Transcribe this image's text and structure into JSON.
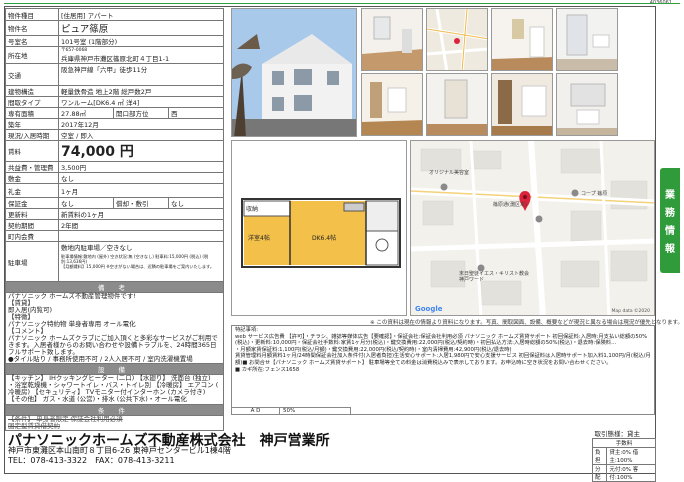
{
  "doc_id": "4036061",
  "rows": [
    {
      "label": "物件種目",
      "value": "[住居用] アパート"
    },
    {
      "label": "物件名",
      "value": "ピュア篠原"
    },
    {
      "label": "号室名",
      "value": "101号室 (1階部分)"
    },
    {
      "label": "所在地",
      "small": "〒657-0068",
      "value": "兵庫県神戸市灘区篠原北町４丁目1-1"
    },
    {
      "label": "交通",
      "value": "阪急神戸線「六甲」徒歩11分"
    },
    {
      "label": "建物構造",
      "value": "軽量鉄骨造 地上2階 総戸数2戸"
    },
    {
      "label": "間取タイプ",
      "value": "ワンルーム[DK6.4 ㎡ 洋4]"
    },
    {
      "label": "専有面積",
      "value": "27.88㎡",
      "label2": "開口部方位",
      "value2": "西"
    },
    {
      "label": "築年",
      "value": "2017年12月"
    },
    {
      "label": "現況/入居時期",
      "value": "空室 / 即入"
    },
    {
      "label": "賃料",
      "value": "74,000 円"
    },
    {
      "label": "共益費・管理費",
      "value": "3,500円"
    },
    {
      "label": "敷金",
      "value": "なし"
    },
    {
      "label": "礼金",
      "value": "1ヶ月"
    },
    {
      "label": "保証金",
      "value": "なし",
      "label2": "償却・敷引",
      "value2": "なし"
    },
    {
      "label": "更新料",
      "value": "新賃料の1ヶ月"
    },
    {
      "label": "契約期間",
      "value": "2年間"
    },
    {
      "label": "町内会費",
      "value": ""
    },
    {
      "label": "駐車場",
      "value": "敷地内駐車場／空きなし",
      "small": "駐車場情報:敷地内 (屋外) 空き状況:無 (空きなし) 駐車料:15,000円 (税込) (税別:13,636円)\n【月額賃料】15,000円 ※空きがない場合は、近隣の駐車場をご案内いたします。"
    }
  ],
  "section_biko": "備 考",
  "biko_text": "パナソニック ホームズ不動産管理物件です!\n【賃貸】\n即入居(内覧可)\n【特徴】\nパナソニック特約物 単身者専用 オール電化\n【コメント】\nパナソニック ホームズクラブにご加入頂くと多彩なサービスがご利用できます。入居者様からのお問い合わせや設備トラブルを、24時間365日フルサポート致します。\n●タイル貼り / 事務所使用不可 / 2人入居不可 / 室内洗濯機置場",
  "section_setsubi": "設 備",
  "setsubi_text": "【キッチン】 IHクッキングヒーター (二口) 【水廻り】 洗面台 (独立)\n・浴室乾燥機・シャワートイレ・バス・トイレ別 【冷暖房】 エアコン (\n冷暖房) 【セキュリティ】 TVモニター付インターホン (カメラ付き)\n【その他】 ガス・水道 (公営)・排水 (公共下水)・オール電化",
  "section_joken": "条 件",
  "joken_text": "【条件】 単身者限定 保証会社利用必須\n固定型賃貸借契約",
  "floor_plan": {
    "closet": "収納",
    "room": "洋室4帖",
    "dk": "DK6.4帖"
  },
  "map": {
    "labels": [
      "オリジナル美容室",
      "篠原通(灘区本)",
      "コープ 篠原",
      "末日聖徒イエス・キリスト教会 神戸ワード",
      "Google",
      "Map data ©2020"
    ]
  },
  "caption": "※ この資料は現在の情報より資料になります。写真、間取図面、設備、概要などが現況と異なる場合は現況が優先となります。",
  "remarks": "特記事項:\nweb サービス広告費 【許可】・チラシ、雑誌等媒体広告【要確認】・保証会社:保証会社利用必須 パナソニック ホームズ賃貸サポート 初回保証料:入居時:月支払い総額の50%(税込)・更新料:10,000円・保証会社手数料:家賃1ヶ月分(税込)・鍵交換費用:22,000円(税込/契約時)・初回払込方法:入居時総額の50%(税込)・退去時:保険料…\n・月額家賃保証料:1,100円(税込/月額)・鍵交換費用:22,000円(税込/契約時)・室内清掃費用:42,900円(税込/退去時)\n賃貸管理料月額賃料1ヶ月/24時間保証会社加入条件付(入居者負担)生活安心サポート:入居1,980円で安心支援サービス 初回保証料は入居時サポート加入料1,100円/月(税込/月額)■ お問合せ【パナソニック ホームズ賃貸サポート】 駐車場等全ての料金は消費税込みで表示しております。お申込時に空き状況をお問い合わせください。\n■ カギ所在:フェンス1658",
  "ad": {
    "label": "A D",
    "value": "50%"
  },
  "company": "パナソニックホームズ不動産株式会社　神戸営業所",
  "address": "神戸市東灘区本山南町８丁目6-26 東神戸センタービル1棟4階",
  "tel": "TEL：078-413-3322　FAX：078-413-3211",
  "deal": {
    "title": "取引態様：貸主",
    "header": "手数料",
    "r1a": "負担",
    "r1b": "貸主:0% 借主:100%",
    "r2a": "分配",
    "r2b": "元付:0% 客付:100%"
  },
  "side_tab": [
    "業",
    "務",
    "情",
    "報"
  ],
  "colors": {
    "accent": "#2e9e3e",
    "section": "#8b8b8b",
    "wall": "#f3c04a",
    "map_marker": "#d9243b"
  }
}
